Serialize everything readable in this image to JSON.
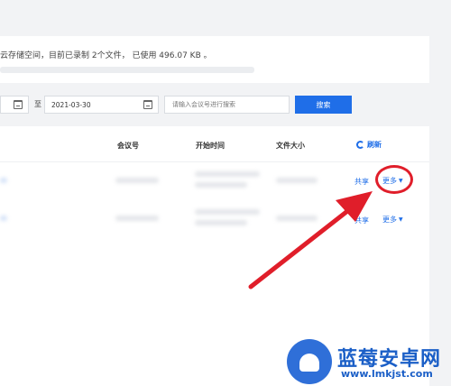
{
  "storage": {
    "text": "云存储空间，目前已录制 2个文件， 已使用 496.07 KB 。",
    "usage_fraction": 0.0
  },
  "filter": {
    "date_from": "",
    "separator": "至",
    "date_to": "2021-03-30",
    "search_placeholder": "请输入会议号进行搜索",
    "search_button": "搜索"
  },
  "table": {
    "columns": [
      "会议号",
      "开始时间",
      "文件大小"
    ],
    "refresh_label": "刷新",
    "rows": [
      {
        "share_label": "共享",
        "more_label": "更多"
      },
      {
        "share_label": "共享",
        "more_label": "更多"
      }
    ]
  },
  "watermark": {
    "title": "蓝莓安卓网",
    "url": "www.lmkjst.com"
  },
  "colors": {
    "accent": "#1f6ee8",
    "annotation": "#e01e2a",
    "watermark": "#1b5fc7"
  },
  "icons": [
    "calendar-icon",
    "refresh-icon",
    "caret-down-icon",
    "watermark-logo-icon"
  ]
}
